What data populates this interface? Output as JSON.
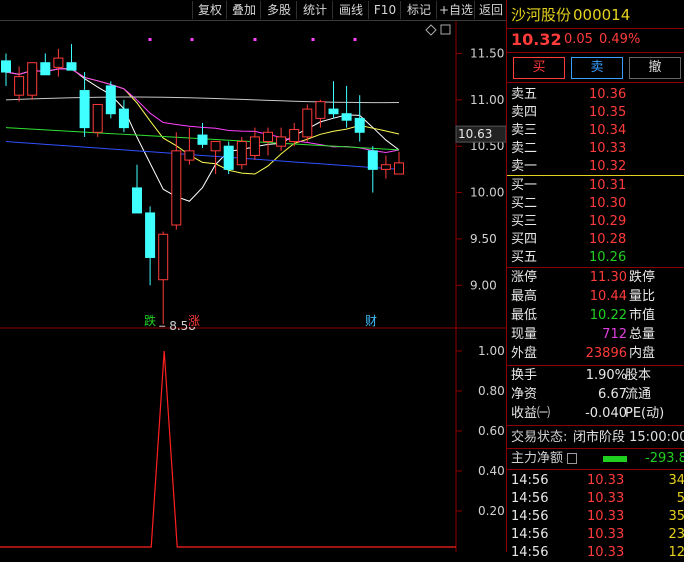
{
  "toolbar": {
    "items": [
      "复权",
      "叠加",
      "多股",
      "统计",
      "画线",
      "F10",
      "标记",
      "+自选",
      "返回"
    ]
  },
  "chart": {
    "price_ticks": [
      "11.50",
      "11.00",
      "10.63",
      "10.50",
      "10.00",
      "9.50",
      "9.00"
    ],
    "current_price_tag": "10.63",
    "low_annotation": "8.58",
    "markers": {
      "die": "跌",
      "zhang": "涨",
      "cai": "财"
    },
    "indicator_ticks": [
      "1.00",
      "0.80",
      "0.60",
      "0.40",
      "0.20"
    ],
    "colors": {
      "up": "#ff3b3b",
      "down": "#40ffff",
      "ma5": "#ffffff",
      "ma10": "#ffff55",
      "ma20": "#ff40ff",
      "ma30": "#30e030",
      "ma60": "#3050ff",
      "ma120": "#c8c8c8"
    }
  },
  "chart_data": {
    "type": "candlestick",
    "candles": [
      {
        "o": 11.42,
        "h": 11.5,
        "l": 11.15,
        "c": 11.3
      },
      {
        "o": 11.05,
        "h": 11.36,
        "l": 10.98,
        "c": 11.25
      },
      {
        "o": 11.05,
        "h": 11.4,
        "l": 11.0,
        "c": 11.4
      },
      {
        "o": 11.4,
        "h": 11.5,
        "l": 11.35,
        "c": 11.27
      },
      {
        "o": 11.35,
        "h": 11.55,
        "l": 11.25,
        "c": 11.45
      },
      {
        "o": 11.4,
        "h": 11.6,
        "l": 11.35,
        "c": 11.32
      },
      {
        "o": 11.1,
        "h": 11.3,
        "l": 10.6,
        "c": 10.7
      },
      {
        "o": 10.65,
        "h": 10.9,
        "l": 10.6,
        "c": 10.95
      },
      {
        "o": 11.15,
        "h": 11.2,
        "l": 10.8,
        "c": 10.85
      },
      {
        "o": 10.9,
        "h": 11.0,
        "l": 10.65,
        "c": 10.7
      },
      {
        "o": 10.05,
        "h": 10.3,
        "l": 9.95,
        "c": 9.78
      },
      {
        "o": 9.78,
        "h": 9.85,
        "l": 9.0,
        "c": 9.3
      },
      {
        "o": 9.06,
        "h": 9.58,
        "l": 8.58,
        "c": 9.55
      },
      {
        "o": 9.65,
        "h": 10.65,
        "l": 9.6,
        "c": 10.45
      },
      {
        "o": 10.35,
        "h": 10.7,
        "l": 10.3,
        "c": 10.45
      },
      {
        "o": 10.62,
        "h": 10.75,
        "l": 10.48,
        "c": 10.52
      },
      {
        "o": 10.45,
        "h": 10.55,
        "l": 10.2,
        "c": 10.55
      },
      {
        "o": 10.5,
        "h": 10.55,
        "l": 10.2,
        "c": 10.25
      },
      {
        "o": 10.3,
        "h": 10.6,
        "l": 10.25,
        "c": 10.55
      },
      {
        "o": 10.4,
        "h": 10.7,
        "l": 10.35,
        "c": 10.6
      },
      {
        "o": 10.55,
        "h": 10.7,
        "l": 10.4,
        "c": 10.65
      },
      {
        "o": 10.5,
        "h": 10.7,
        "l": 10.45,
        "c": 10.6
      },
      {
        "o": 10.55,
        "h": 10.75,
        "l": 10.5,
        "c": 10.68
      },
      {
        "o": 10.6,
        "h": 10.95,
        "l": 10.55,
        "c": 10.9
      },
      {
        "o": 10.8,
        "h": 11.0,
        "l": 10.7,
        "c": 10.98
      },
      {
        "o": 10.9,
        "h": 11.2,
        "l": 10.8,
        "c": 10.85
      },
      {
        "o": 10.85,
        "h": 11.15,
        "l": 10.7,
        "c": 10.78
      },
      {
        "o": 10.8,
        "h": 11.05,
        "l": 10.55,
        "c": 10.65
      },
      {
        "o": 10.45,
        "h": 10.5,
        "l": 10.0,
        "c": 10.25
      },
      {
        "o": 10.25,
        "h": 10.4,
        "l": 10.15,
        "c": 10.3
      },
      {
        "o": 10.2,
        "h": 10.44,
        "l": 10.22,
        "c": 10.32
      }
    ],
    "indicator": {
      "peak_index": 12,
      "values_note_peak": 1.0,
      "yrange": [
        0,
        1.0
      ]
    },
    "yrange": [
      8.55,
      11.85
    ]
  },
  "quote": {
    "name": "沙河股份",
    "code": "000014",
    "price": "10.32",
    "change": "0.05",
    "pct": "0.49%",
    "buy_btn": "买",
    "sell_btn": "卖",
    "cancel_btn": "撤",
    "asks": [
      {
        "label": "卖五",
        "price": "10.36"
      },
      {
        "label": "卖四",
        "price": "10.35"
      },
      {
        "label": "卖三",
        "price": "10.34"
      },
      {
        "label": "卖二",
        "price": "10.33"
      },
      {
        "label": "卖一",
        "price": "10.32"
      }
    ],
    "bids": [
      {
        "label": "买一",
        "price": "10.31"
      },
      {
        "label": "买二",
        "price": "10.30"
      },
      {
        "label": "买三",
        "price": "10.29"
      },
      {
        "label": "买四",
        "price": "10.28"
      },
      {
        "label": "买五",
        "price": "10.26"
      }
    ],
    "stats": [
      {
        "l1": "涨停",
        "v1": "11.30",
        "l2": "跌停"
      },
      {
        "l1": "最高",
        "v1": "10.44",
        "l2": "量比"
      },
      {
        "l1": "最低",
        "v1": "10.22",
        "l2": "市值"
      },
      {
        "l1": "现量",
        "v1": "712",
        "l2": "总量"
      },
      {
        "l1": "外盘",
        "v1": "23896",
        "l2": "内盘"
      }
    ],
    "stats2": [
      {
        "l1": "换手",
        "v1": "1.90%",
        "l2": "股本"
      },
      {
        "l1": "净资",
        "v1": "6.67",
        "l2": "流通"
      },
      {
        "l1": "收益㈠",
        "v1": "-0.040",
        "l2": "PE(动)"
      }
    ],
    "status_label": "交易状态:",
    "status_value": "闭市阶段 15:00:00",
    "netflow_label": "主力净额",
    "netflow_value": "-293.8",
    "ticks": [
      {
        "time": "14:56",
        "price": "10.33",
        "vol": "34"
      },
      {
        "time": "14:56",
        "price": "10.33",
        "vol": "5"
      },
      {
        "time": "14:56",
        "price": "10.33",
        "vol": "35"
      },
      {
        "time": "14:56",
        "price": "10.33",
        "vol": "23"
      },
      {
        "time": "14:56",
        "price": "10.33",
        "vol": "12"
      }
    ]
  }
}
